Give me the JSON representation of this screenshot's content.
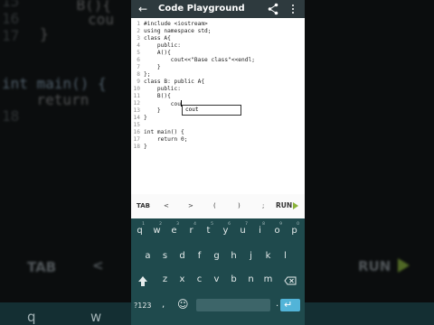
{
  "app": {
    "title": "Code Playground",
    "icons": {
      "back": "arrow-back-icon",
      "share": "share-icon",
      "more": "more-vert-icon"
    }
  },
  "editor": {
    "lines": [
      {
        "n": "1",
        "text": "#include <iostream>"
      },
      {
        "n": "2",
        "text": "using namespace std;"
      },
      {
        "n": "3",
        "text": "class A{"
      },
      {
        "n": "4",
        "text": "    public:"
      },
      {
        "n": "5",
        "text": "    A(){"
      },
      {
        "n": "6",
        "text": "        cout<<\"Base class\"<<endl;"
      },
      {
        "n": "7",
        "text": "    }"
      },
      {
        "n": "8",
        "text": "};"
      },
      {
        "n": "9",
        "text": "class B: public A{"
      },
      {
        "n": "10",
        "text": "    public:"
      },
      {
        "n": "11",
        "text": "    B(){"
      },
      {
        "n": "12",
        "text": "        cou"
      },
      {
        "n": "13",
        "text": "    }"
      },
      {
        "n": "14",
        "text": "}"
      },
      {
        "n": "15",
        "text": ""
      },
      {
        "n": "16",
        "text": "int main() {"
      },
      {
        "n": "17",
        "text": "    return 0;"
      },
      {
        "n": "18",
        "text": "}"
      }
    ],
    "suggestion": "cout"
  },
  "toolbar": {
    "tab": "TAB",
    "left": "<",
    "right": ">",
    "lparen": "(",
    "rparen": ")",
    "semicolon": ";",
    "run": "RUN"
  },
  "keyboard": {
    "row1": [
      {
        "key": "q",
        "num": "1"
      },
      {
        "key": "w",
        "num": "2"
      },
      {
        "key": "e",
        "num": "3"
      },
      {
        "key": "r",
        "num": "4"
      },
      {
        "key": "t",
        "num": "5"
      },
      {
        "key": "y",
        "num": "6"
      },
      {
        "key": "u",
        "num": "7"
      },
      {
        "key": "i",
        "num": "8"
      },
      {
        "key": "o",
        "num": "9"
      },
      {
        "key": "p",
        "num": "0"
      }
    ],
    "row2": [
      "a",
      "s",
      "d",
      "f",
      "g",
      "h",
      "j",
      "k",
      "l"
    ],
    "row3": [
      "z",
      "x",
      "c",
      "v",
      "b",
      "n",
      "m"
    ],
    "symbols": "?123",
    "comma": ",",
    "emoji": "☺",
    "period": ".",
    "enter": "↵"
  },
  "background": {
    "left_lines": [
      {
        "n": "15",
        "text": "    B(){"
      },
      {
        "n": "",
        "text": "        cou"
      },
      {
        "n": "16",
        "text": "    }"
      },
      {
        "n": "17",
        "text": "}"
      },
      {
        "n": "",
        "text": ""
      },
      {
        "n": "",
        "text": "int main() {"
      },
      {
        "n": "",
        "text": "    return"
      },
      {
        "n": "18",
        "text": "}"
      }
    ],
    "left_tab": "TAB",
    "left_lt": "<",
    "right_run": "RUN",
    "key_letters": [
      "q",
      "w"
    ]
  },
  "colors": {
    "appbar": "#2e3a3e",
    "keyboard": "#1f4a4d",
    "run_accent": "#8ab33a",
    "enter_key": "#52b4d8"
  }
}
